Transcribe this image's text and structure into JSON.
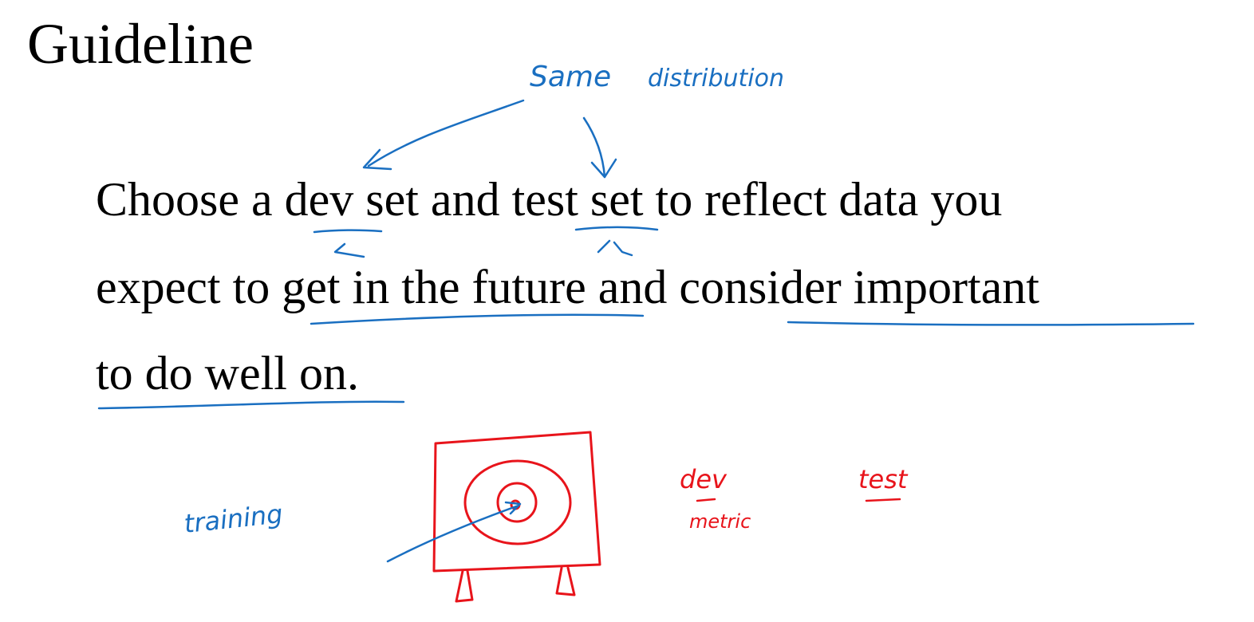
{
  "slide": {
    "title": "Guideline",
    "body": {
      "line1": {
        "s1": "Choose a ",
        "dev": "dev",
        "s2": " set and ",
        "test": "test",
        "s3": " set to reflect data you"
      },
      "line2": {
        "s1": "expect to ",
        "future": "get in the future",
        "s2": " and ",
        "important": "consider important"
      },
      "line3": {
        "s1": "to do well on."
      }
    }
  },
  "annotations": {
    "note_same": "Same",
    "note_distribution": "distribution",
    "note_training": "training",
    "note_dev": "dev",
    "note_metric": "metric",
    "note_test": "test",
    "colors": {
      "blue_ink": "#1a6fc1",
      "red_ink": "#e8141b",
      "text": "#000000"
    },
    "icons": {
      "target": "target-on-easel-drawing",
      "arrow": "hand-drawn-arrow"
    }
  }
}
